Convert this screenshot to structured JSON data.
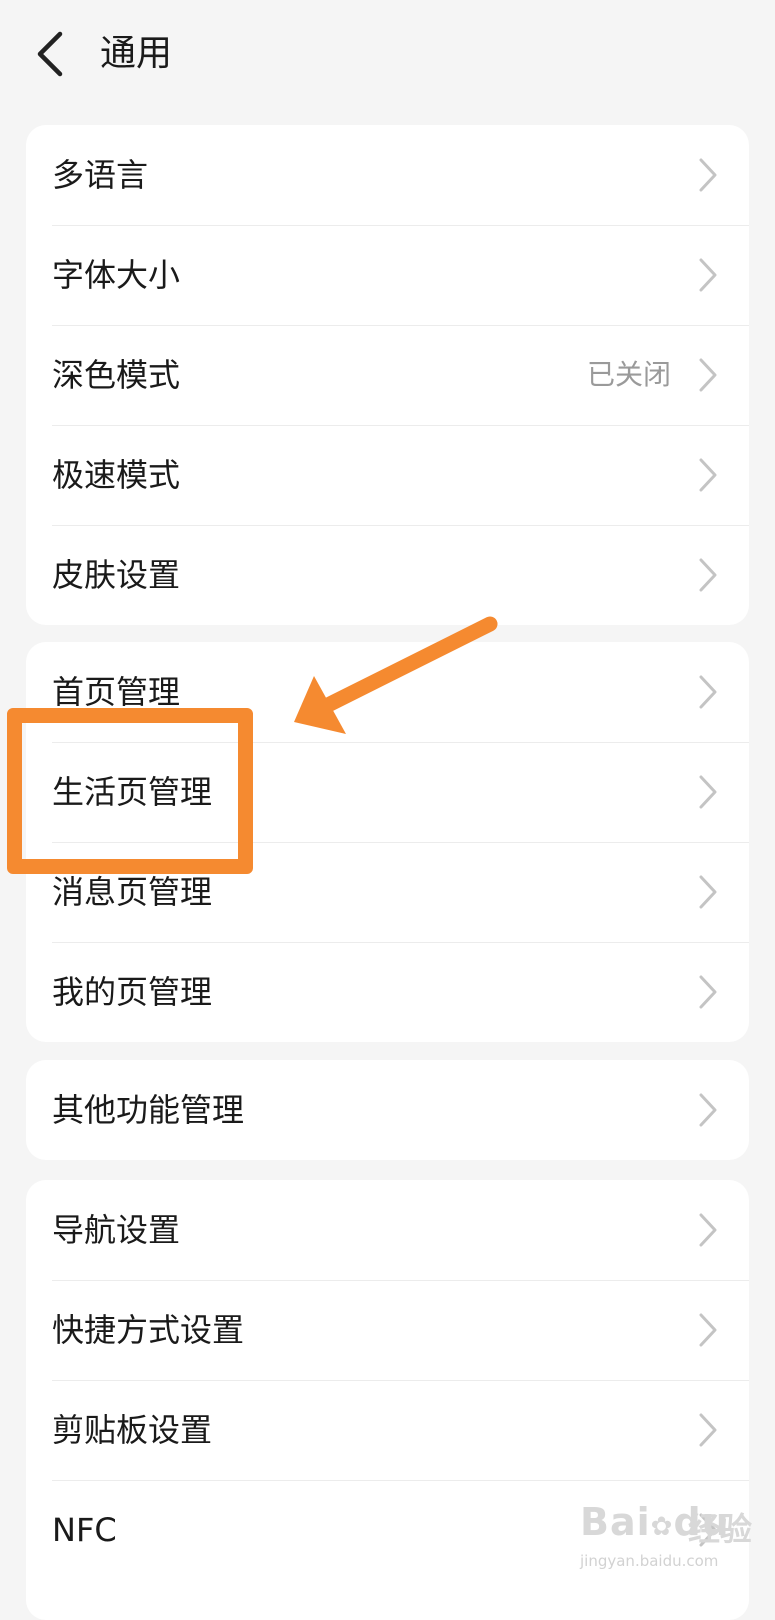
{
  "header": {
    "title": "通用"
  },
  "groups": [
    {
      "items": [
        {
          "label": "多语言",
          "value": ""
        },
        {
          "label": "字体大小",
          "value": ""
        },
        {
          "label": "深色模式",
          "value": "已关闭"
        },
        {
          "label": "极速模式",
          "value": ""
        },
        {
          "label": "皮肤设置",
          "value": ""
        }
      ]
    },
    {
      "items": [
        {
          "label": "首页管理",
          "value": ""
        },
        {
          "label": "生活页管理",
          "value": ""
        },
        {
          "label": "消息页管理",
          "value": ""
        },
        {
          "label": "我的页管理",
          "value": ""
        }
      ]
    },
    {
      "items": [
        {
          "label": "其他功能管理",
          "value": ""
        }
      ]
    },
    {
      "items": [
        {
          "label": "导航设置",
          "value": ""
        },
        {
          "label": "快捷方式设置",
          "value": ""
        },
        {
          "label": "剪贴板设置",
          "value": ""
        },
        {
          "label": "NFC",
          "value": ""
        }
      ]
    }
  ],
  "annotation": {
    "color": "#f58a30"
  },
  "watermark": {
    "brand": "Bai",
    "brand_tail": "du",
    "cn": "经验",
    "url": "jingyan.baidu.com"
  }
}
